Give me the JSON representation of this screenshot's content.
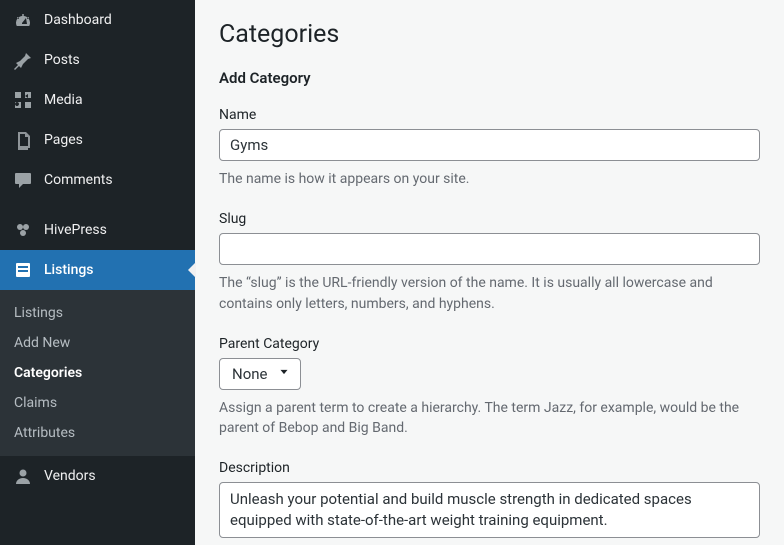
{
  "sidebar": {
    "items": [
      {
        "label": "Dashboard",
        "icon": "dashboard"
      },
      {
        "label": "Posts",
        "icon": "pin"
      },
      {
        "label": "Media",
        "icon": "media"
      },
      {
        "label": "Pages",
        "icon": "pages"
      },
      {
        "label": "Comments",
        "icon": "comment"
      },
      {
        "label": "HivePress",
        "icon": "hivepress"
      },
      {
        "label": "Listings",
        "icon": "listings",
        "active": true
      },
      {
        "label": "Vendors",
        "icon": "vendor"
      }
    ],
    "submenu": [
      {
        "label": "Listings"
      },
      {
        "label": "Add New"
      },
      {
        "label": "Categories",
        "current": true
      },
      {
        "label": "Claims"
      },
      {
        "label": "Attributes"
      }
    ]
  },
  "page": {
    "title": "Categories",
    "section_title": "Add Category"
  },
  "form": {
    "name": {
      "label": "Name",
      "value": "Gyms",
      "description": "The name is how it appears on your site."
    },
    "slug": {
      "label": "Slug",
      "value": "",
      "description": "The “slug” is the URL-friendly version of the name. It is usually all lowercase and contains only letters, numbers, and hyphens."
    },
    "parent": {
      "label": "Parent Category",
      "selected": "None",
      "description": "Assign a parent term to create a hierarchy. The term Jazz, for example, would be the parent of Bebop and Big Band."
    },
    "description": {
      "label": "Description",
      "value": "Unleash your potential and build muscle strength in dedicated spaces equipped with state-of-the-art weight training equipment."
    }
  }
}
